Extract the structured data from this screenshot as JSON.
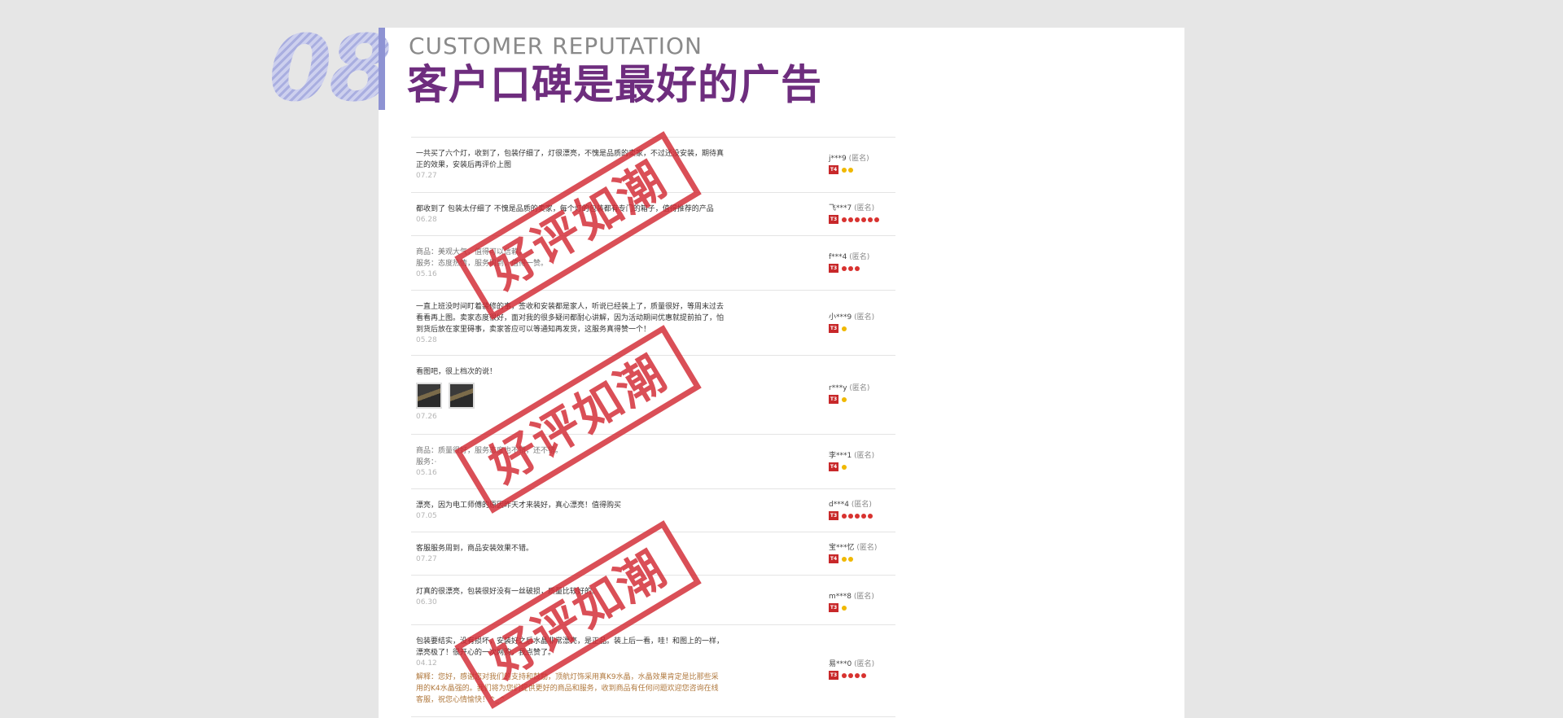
{
  "header": {
    "number": "08",
    "subtitle": "CUSTOMER REPUTATION",
    "title": "客户口碑是最好的广告"
  },
  "stamp_text": "好评如潮",
  "colors": {
    "title": "#6e2d7e",
    "accent_bar": "#8e93d3",
    "stamp": "#d2283a",
    "level_badge": "#c8282a"
  },
  "reviews": [
    {
      "text": "一共买了六个灯，收到了，包装仔细了，灯很漂亮，不愧是品质的卖家，不过还没安装，期待真正的效果，安装后再评价上图",
      "date": "07.27",
      "user": "j***9",
      "anon": "(匿名)",
      "level": "T4",
      "gems": [
        "yellow",
        "yellow"
      ]
    },
    {
      "text": "都收到了 包装太仔细了 不愧是品质的卖家，每个灯的包装都有专门的箱子，值得推荐的产品",
      "date": "06.28",
      "user": "飞***7",
      "anon": "(匿名)",
      "level": "T3",
      "gems": [
        "red",
        "red",
        "red",
        "red",
        "red",
        "red"
      ]
    },
    {
      "text1": "商品：美观大气，值得可以信赖。",
      "text2": "服务：态度热情，服务周到，值得一赞。",
      "date": "05.16",
      "user": "f***4",
      "anon": "(匿名)",
      "level": "T3",
      "gems": [
        "red",
        "red",
        "red"
      ]
    },
    {
      "text": "一直上班没时间盯着装修的事，签收和安装都是家人，听说已经装上了，质量很好，等周末过去看看再上图。卖家态度很好，面对我的很多疑问都耐心讲解，因为活动期间优惠就提前拍了，怕到货后放在家里碍事，卖家答应可以等通知再发货，这服务真得赞一个！",
      "date": "05.28",
      "user": "小***9",
      "anon": "(匿名)",
      "level": "T3",
      "gems": [
        "yellow"
      ]
    },
    {
      "text": "看图吧，很上档次的说！",
      "date": "07.26",
      "user": "r***y",
      "anon": "(匿名)",
      "level": "T3",
      "gems": [
        "yellow"
      ]
    },
    {
      "text1": "商品：质量很好，服务态度也不错，还不错。",
      "text2": "服务：·",
      "date": "05.16",
      "user": "李***1",
      "anon": "(匿名)",
      "level": "T4",
      "gems": [
        "yellow"
      ]
    },
    {
      "text": "漂亮，因为电工师傅的原因昨天才来装好，真心漂亮！值得购买",
      "date": "07.05",
      "user": "d***4",
      "anon": "(匿名)",
      "level": "T3",
      "gems": [
        "red",
        "red",
        "red",
        "red",
        "red"
      ]
    },
    {
      "text": "客服服务周到，商品安装效果不错。",
      "date": "07.27",
      "user": "宝***忆",
      "anon": "(匿名)",
      "level": "T4",
      "gems": [
        "yellow",
        "yellow"
      ]
    },
    {
      "text": "灯真的很漂亮，包装很好没有一丝破损，质量比较好的。",
      "date": "06.30",
      "user": "m***8",
      "anon": "(匿名)",
      "level": "T3",
      "gems": [
        "yellow"
      ]
    },
    {
      "text": "包装要结实，没有损坏，安装好之后水晶非常漂亮，是正品。装上后一看，哇！和图上的一样，漂亮极了！很开心的一次网购，我点赞了。",
      "date": "04.12",
      "reply": "解释：您好，感谢您对我们的支持和鼓励，顶航灯饰采用真K9水晶，水晶效果肯定是比那些采用的K4水晶强的。我们将为您们提供更好的商品和服务，收到商品有任何问题欢迎您咨询在线客服，祝您心情愉快！^_^",
      "user": "易***0",
      "anon": "(匿名)",
      "level": "T3",
      "gems": [
        "red",
        "red",
        "red",
        "red"
      ]
    }
  ]
}
